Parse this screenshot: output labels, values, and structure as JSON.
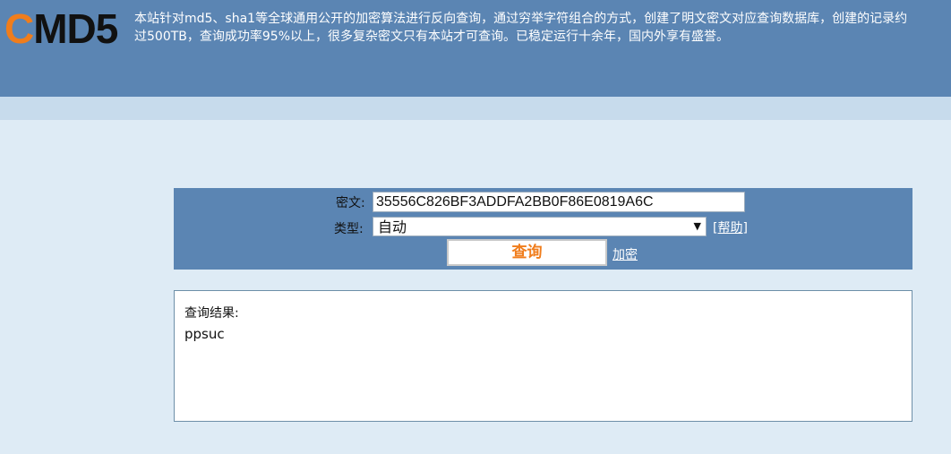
{
  "header": {
    "logo_accent": "C",
    "logo_rest": "MD5",
    "intro_line1": "本站针对md5、sha1等全球通用公开的加密算法进行反向查询，通过穷举字符组合的方式，创建了明文密文对应查询数据库，创建的记录约",
    "intro_line2": "过500TB，查询成功率95%以上，很多复杂密文只有本站才可查询。已稳定运行十余年，国内外享有盛誉。"
  },
  "query": {
    "cipher_label": "密文:",
    "cipher_value": "35556C826BF3ADDFA2BB0F86E0819A6C",
    "type_label": "类型:",
    "type_value": "自动",
    "help_link": "[帮助]",
    "submit_label": "查询",
    "encrypt_link": "加密"
  },
  "result": {
    "title": "查询结果:",
    "value": "ppsuc"
  },
  "colors": {
    "header_bg": "#5b85b3",
    "subbar_bg": "#c7dbec",
    "page_bg": "#deebf5",
    "accent_orange": "#f07d1c"
  }
}
